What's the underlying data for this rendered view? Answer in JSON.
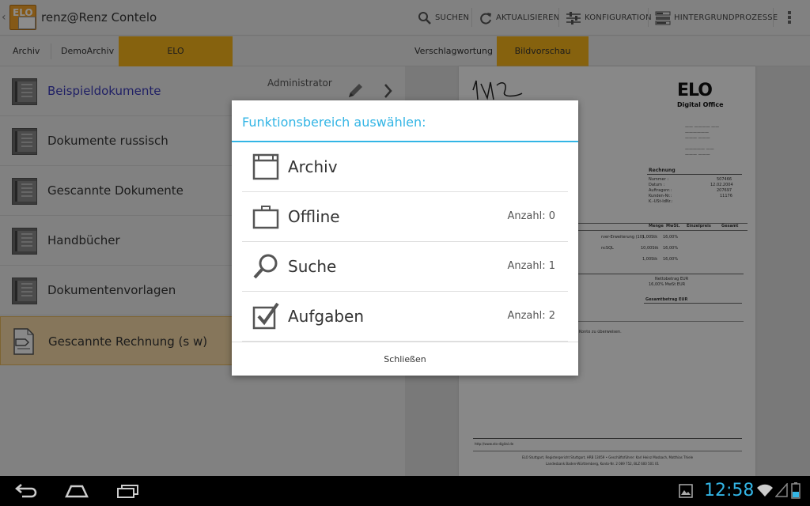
{
  "app": {
    "title": "renz@Renz Contelo",
    "logo_text": "ELO"
  },
  "actions": [
    {
      "label": "SUCHEN",
      "icon": "search-icon"
    },
    {
      "label": "AKTUALISIEREN",
      "icon": "refresh-icon"
    },
    {
      "label": "KONFIGURATION",
      "icon": "settings-sliders-icon"
    },
    {
      "label": "HINTERGRUNDPROZESSE",
      "icon": "background-tasks-icon"
    }
  ],
  "breadcrumb_tabs": [
    "Archiv",
    "DemoArchiv",
    "ELO Beispieldokumente"
  ],
  "right_tabs": [
    "Verschlagwortung",
    "Bildvorschau"
  ],
  "list": {
    "owner": "Administrator",
    "items": [
      {
        "label": "Beispieldokumente",
        "icon": "folder-icon"
      },
      {
        "label": "Dokumente russisch",
        "icon": "folder-icon"
      },
      {
        "label": "Gescannte Dokumente",
        "icon": "folder-icon"
      },
      {
        "label": "Handbücher",
        "icon": "folder-icon"
      },
      {
        "label": "Dokumentenvorlagen",
        "icon": "folder-icon"
      },
      {
        "label": "Gescannte Rechnung (s w)",
        "icon": "document-icon"
      }
    ]
  },
  "preview": {
    "logo": "ELO",
    "logo_sub": "Digital Office",
    "heading": "Rechnung",
    "fields": [
      "Nummer :",
      "Datum :",
      "Auftragsnr.:",
      "Kunden-Nr.:",
      "K.-USt-IdNr.:"
    ],
    "field_values": [
      "507466",
      "12.02.2004",
      "207697",
      "11176",
      ""
    ],
    "columns": [
      "Menge",
      "MwSt.",
      "Einzelpreis",
      "Gesamt"
    ],
    "lines": [
      {
        "text": "rver-Erweiterung (10)",
        "qty": "1,00Stk",
        "vat": "16,00%"
      },
      {
        "text": "ncSQL",
        "qty": "10,00Stk",
        "vat": "16,00%"
      },
      {
        "text": "",
        "qty": "1,00Stk",
        "vat": "16,00%"
      }
    ],
    "net": "Nettobetrag  EUR",
    "vat_line": "16,00% MwSt  EUR",
    "gross": "Gesamtbetrag  EUR",
    "note": "Konto zu überweisen.",
    "footer_url": "http://www.elo-digital.de",
    "footer_text": "ELO Stuttgart, Registergericht Stuttgart, HRB 13059 • Geschäftsführer: Karl Heinz Mosbach, Matthias Thiele",
    "footer_text2": "Landesbank Baden-Württemberg, Konto-Nr. 2 089 752, BLZ 600 501 01"
  },
  "dialog": {
    "title": "Funktionsbereich auswählen:",
    "options": [
      {
        "label": "Archiv",
        "count": "",
        "icon": "archive-window-icon"
      },
      {
        "label": "Offline",
        "count": "Anzahl: 0",
        "icon": "briefcase-icon"
      },
      {
        "label": "Suche",
        "count": "Anzahl: 1",
        "icon": "search-icon"
      },
      {
        "label": "Aufgaben",
        "count": "Anzahl: 2",
        "icon": "checkbox-icon"
      }
    ],
    "close_label": "Schließen"
  },
  "statusbar": {
    "time": "12:58"
  }
}
